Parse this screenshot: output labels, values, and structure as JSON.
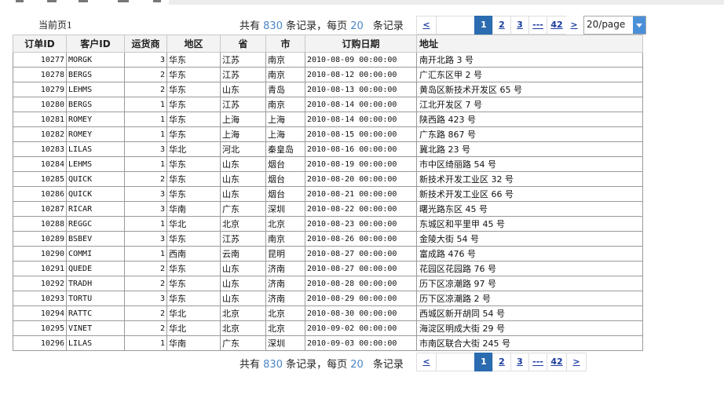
{
  "toolbar": {
    "current_page_label": "当前页",
    "current_page": "1"
  },
  "summary": {
    "total_prefix": "共有",
    "total_count": "830",
    "total_suffix": "条记录，每页",
    "per_page": "20",
    "per_page_suffix": "条记录"
  },
  "pager": {
    "prev": "<",
    "next": ">",
    "pages": [
      "1",
      "2",
      "3",
      "---",
      "42"
    ],
    "active_page": "1",
    "page_size": "20/page"
  },
  "table": {
    "columns": [
      "订单ID",
      "客户ID",
      "运货商",
      "地区",
      "省",
      "市",
      "订购日期",
      "地址"
    ],
    "rows": [
      [
        "10277",
        "MORGK",
        "3",
        "华东",
        "江苏",
        "南京",
        "2010-08-09 00:00:00",
        "南开北路 3 号"
      ],
      [
        "10278",
        "BERGS",
        "2",
        "华东",
        "江苏",
        "南京",
        "2010-08-12 00:00:00",
        "广汇东区甲 2 号"
      ],
      [
        "10279",
        "LEHMS",
        "2",
        "华东",
        "山东",
        "青岛",
        "2010-08-13 00:00:00",
        "黄岛区新技术开发区 65 号"
      ],
      [
        "10280",
        "BERGS",
        "1",
        "华东",
        "江苏",
        "南京",
        "2010-08-14 00:00:00",
        "江北开发区 7 号"
      ],
      [
        "10281",
        "ROMEY",
        "1",
        "华东",
        "上海",
        "上海",
        "2010-08-14 00:00:00",
        "陕西路 423 号"
      ],
      [
        "10282",
        "ROMEY",
        "1",
        "华东",
        "上海",
        "上海",
        "2010-08-15 00:00:00",
        "广东路 867 号"
      ],
      [
        "10283",
        "LILAS",
        "3",
        "华北",
        "河北",
        "秦皇岛",
        "2010-08-16 00:00:00",
        "冀北路 23 号"
      ],
      [
        "10284",
        "LEHMS",
        "1",
        "华东",
        "山东",
        "烟台",
        "2010-08-19 00:00:00",
        "市中区绮丽路 54 号"
      ],
      [
        "10285",
        "QUICK",
        "2",
        "华东",
        "山东",
        "烟台",
        "2010-08-20 00:00:00",
        "新技术开发工业区 32 号"
      ],
      [
        "10286",
        "QUICK",
        "3",
        "华东",
        "山东",
        "烟台",
        "2010-08-21 00:00:00",
        "新技术开发工业区 66 号"
      ],
      [
        "10287",
        "RICAR",
        "3",
        "华南",
        "广东",
        "深圳",
        "2010-08-22 00:00:00",
        "曙光路东区 45 号"
      ],
      [
        "10288",
        "REGGC",
        "1",
        "华北",
        "北京",
        "北京",
        "2010-08-23 00:00:00",
        "东城区和平里甲 45 号"
      ],
      [
        "10289",
        "BSBEV",
        "3",
        "华东",
        "江苏",
        "南京",
        "2010-08-26 00:00:00",
        "金陵大街 54 号"
      ],
      [
        "10290",
        "COMMI",
        "1",
        "西南",
        "云南",
        "昆明",
        "2010-08-27 00:00:00",
        "富成路 476 号"
      ],
      [
        "10291",
        "QUEDE",
        "2",
        "华东",
        "山东",
        "济南",
        "2010-08-27 00:00:00",
        "花园区花园路 76 号"
      ],
      [
        "10292",
        "TRADH",
        "2",
        "华东",
        "山东",
        "济南",
        "2010-08-28 00:00:00",
        "历下区凉潮路 97 号"
      ],
      [
        "10293",
        "TORTU",
        "3",
        "华东",
        "山东",
        "济南",
        "2010-08-29 00:00:00",
        "历下区凉潮路 2 号"
      ],
      [
        "10294",
        "RATTC",
        "2",
        "华北",
        "北京",
        "北京",
        "2010-08-30 00:00:00",
        "西城区新开胡同 54 号"
      ],
      [
        "10295",
        "VINET",
        "2",
        "华北",
        "北京",
        "北京",
        "2010-09-02 00:00:00",
        "海淀区明成大街 29 号"
      ],
      [
        "10296",
        "LILAS",
        "1",
        "华南",
        "广东",
        "深圳",
        "2010-09-03 00:00:00",
        "市南区联合大街 245 号"
      ]
    ]
  },
  "colors": {
    "accent": "#2b6bb0",
    "link": "#1a3c9e",
    "count_highlight": "#4a86c5",
    "dropdown_button": "#4a90d9"
  }
}
